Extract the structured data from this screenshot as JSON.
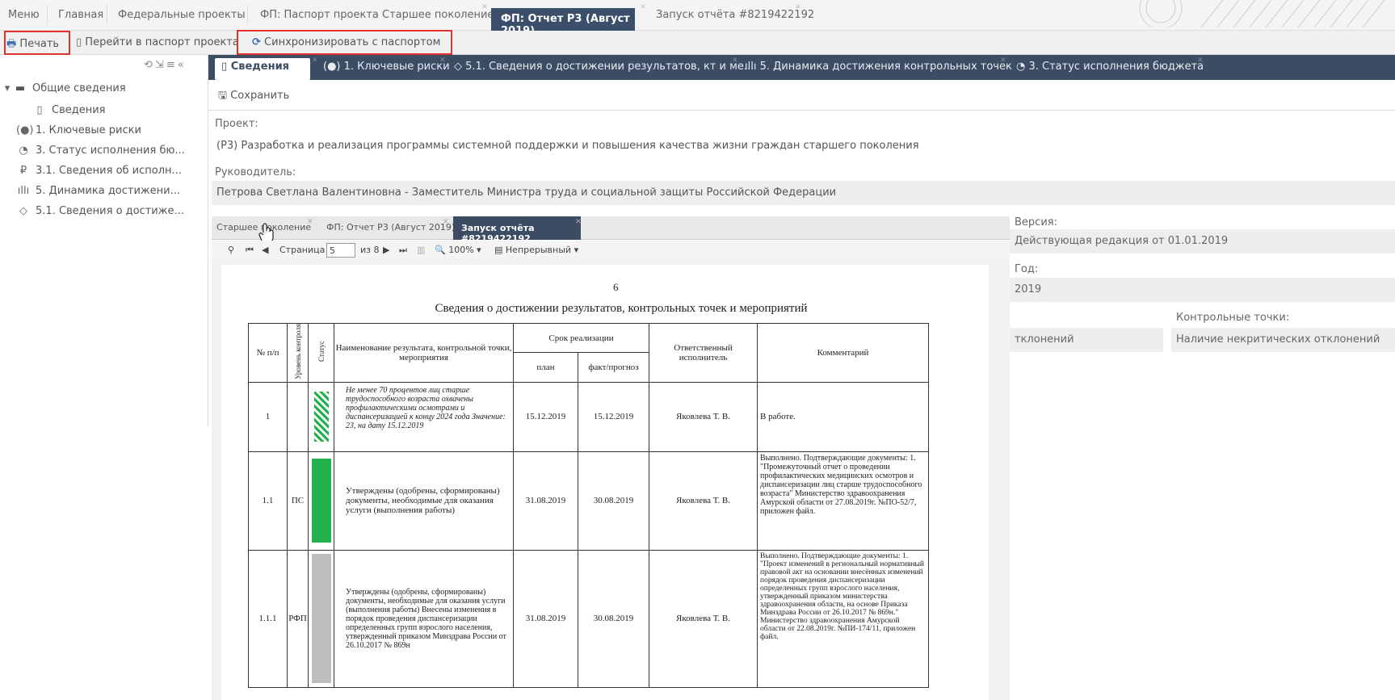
{
  "nav": {
    "items": [
      "Меню",
      "Главная",
      "Федеральные проекты",
      "ФП: Паспорт проекта Старшее поколение"
    ],
    "active_tab": "ФП: Отчет Р3 (Август 2019)",
    "launch_tab": "Запуск отчёта #8219422192"
  },
  "toolbar": {
    "print": "Печать",
    "goto_passport": "Перейти в паспорт проекта",
    "sync": "Синхронизировать с паспортом"
  },
  "tree": {
    "root": "Общие сведения",
    "child": "Сведения",
    "items": [
      "1. Ключевые риски",
      "3. Статус исполнения бю...",
      "3.1. Сведения об исполн...",
      "5. Динамика достижени...",
      "5.1. Сведения о достиже..."
    ]
  },
  "section_tabs": [
    "Сведения",
    "1. Ключевые риски",
    "5.1. Сведения о достижении результатов, кт и ме...",
    "5. Динамика достижения контрольных точек",
    "3. Статус исполнения бюджета"
  ],
  "save_label": "Сохранить",
  "project": {
    "label": "Проект:",
    "value": "(Р3) Разработка и реализация программы системной поддержки и повышения качества жизни граждан старшего поколения"
  },
  "manager": {
    "label": "Руководитель:",
    "value": "Петрова Светлана Валентиновна  - Заместитель Министра труда и социальной защиты Российской Федерации"
  },
  "version": {
    "label": "Версия:",
    "value": "Действующая редакция от 01.01.2019"
  },
  "year": {
    "label": "Год:",
    "value": "2019"
  },
  "control_points": {
    "label": "Контрольные точки:",
    "value": "Наличие некритических отклонений"
  },
  "deviations_value": "тклонений",
  "report_tabs": [
    "Старшее поколение",
    "ФП: Отчет Р3 (Август 2019)",
    "Запуск отчёта #8219422192"
  ],
  "viewer": {
    "page_label": "Страница",
    "page_value": "5",
    "page_of": "из 8",
    "zoom": "100%",
    "mode": "Непрерывный"
  },
  "report": {
    "page_number": "6",
    "title": "Сведения о достижении результатов, контрольных точек и мероприятий",
    "headers": {
      "num": "№ п/п",
      "level": "Уровень контроля",
      "status": "Статус",
      "name": "Наименование результата, контрольной точки, мероприятия",
      "term": "Срок реализации",
      "plan": "план",
      "fact": "факт/прогноз",
      "resp": "Ответственный исполнитель",
      "comment": "Комментарий"
    },
    "rows": [
      {
        "num": "1",
        "level": "",
        "name": "Не менее 70 процентов лиц старше трудоспособного возраста охвачены профилактическими осмотрами и диспансеризацией к концу 2024 года Значение: 23, на дату 15.12.2019",
        "plan": "15.12.2019",
        "fact": "15.12.2019",
        "resp": "Яковлева Т. В.",
        "comment": "В работе."
      },
      {
        "num": "1.1",
        "level": "ПС",
        "name": "Утверждены (одобрены, сформированы) документы, необходимые для оказания услуги (выполнения работы)",
        "plan": "31.08.2019",
        "fact": "30.08.2019",
        "resp": "Яковлева Т. В.",
        "comment": "Выполнено. Подтверждающие документы: 1. \"Промежуточный отчет о проведении профилактических медицинских осмотров и диспансеризации лиц старше трудоспособного возраста\" Министерство здравоохранения Амурской области от 27.08.2019г. №ПО-52/7, приложен файл."
      },
      {
        "num": "1.1.1",
        "level": "РФП",
        "name": "Утверждены (одобрены, сформированы) документы, необходимые для оказания услуги (выполнения работы) Внесены изменения в порядок проведения диспансеризации определенных групп взрослого населения, утвержденный приказом Минздрава России от 26.10.2017 № 869н",
        "plan": "31.08.2019",
        "fact": "30.08.2019",
        "resp": "Яковлева Т. В.",
        "comment": "Выполнено. Подтверждающие документы: 1. \"Проект изменений в региональный нормативный правовой акт на основании внесённых изменений порядок проведения диспансеризации определенных групп взрослого населения, утвержденный приказом министерства здравоохранения области, на основе Приказа Минздрава России от 26.10.2017 № 869н.\" Министерство здравоохранения Амурской области от 22.08.2019г. №ПИ-174/11, приложен файл."
      }
    ]
  }
}
